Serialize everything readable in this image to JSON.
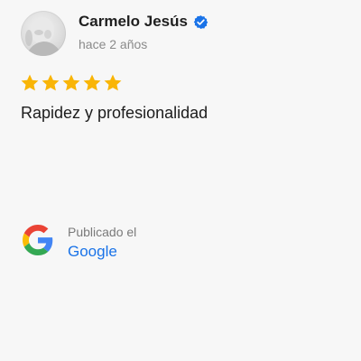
{
  "review": {
    "author": {
      "name": "Carmelo Jesús",
      "verified_icon": "verified-badge-icon",
      "avatar": "avatar-photo"
    },
    "time_ago": "hace 2 años",
    "rating": {
      "value": 5,
      "max": 5,
      "star_color": "#f9b506"
    },
    "text": "Rapidez y profesionalidad"
  },
  "source": {
    "label": "Publicado el",
    "platform": "Google",
    "icon": "google-g-icon",
    "link_color": "#1a73e8"
  },
  "colors": {
    "background": "#f7f7f7",
    "verified_blue": "#1a73e8"
  }
}
